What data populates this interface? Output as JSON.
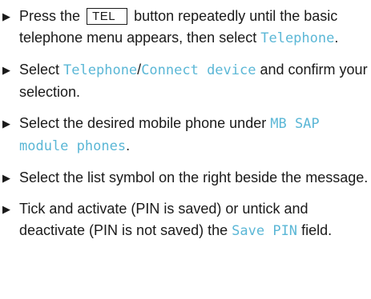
{
  "bullet_glyph": "▶",
  "colors": {
    "text": "#1a1a1a",
    "menu_text": "#5bb7d6",
    "background": "#ffffff"
  },
  "steps": [
    {
      "t1": "Press the",
      "key": "TEL",
      "t2": "button repeatedly until the basic telephone menu appears, then select",
      "m1": "Telephone",
      "t3": "."
    },
    {
      "t1": "Select",
      "m1": "Telephone",
      "sep": "/",
      "m2": "Connect device",
      "t2": "and confirm your selection."
    },
    {
      "t1": "Select the desired mobile phone under",
      "m1": "MB SAP module phones",
      "t2": "."
    },
    {
      "t1": "Select the list symbol on the right beside the message."
    },
    {
      "t1": "Tick and activate (PIN is saved) or untick and deactivate (PIN is not saved) the",
      "m1": "Save PIN",
      "t2": "field."
    }
  ]
}
